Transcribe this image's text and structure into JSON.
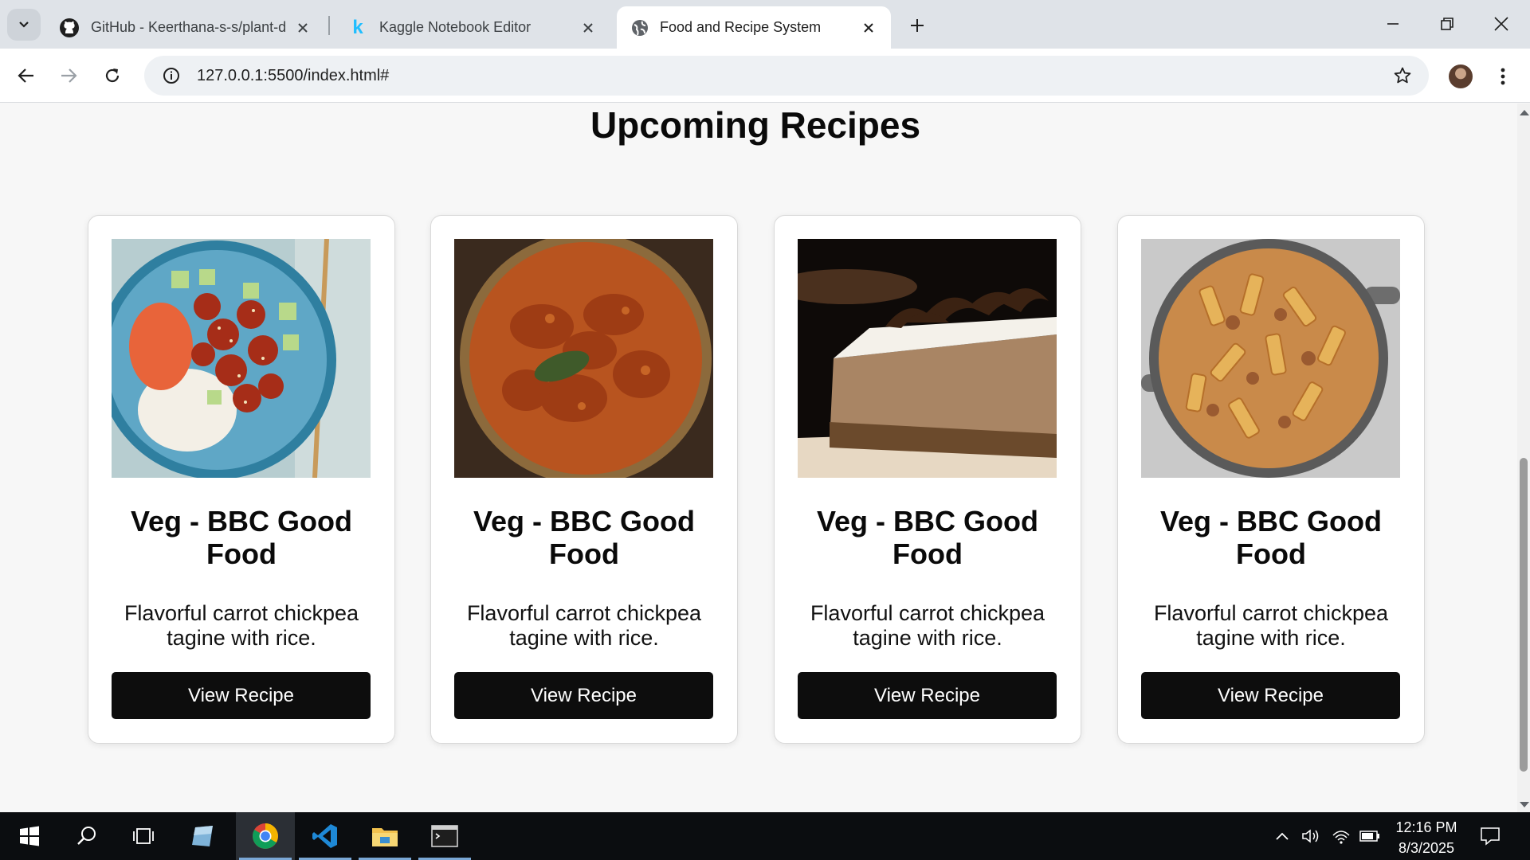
{
  "browser": {
    "tabs": [
      {
        "title": "GitHub - Keerthana-s-s/plant-d",
        "icon": "github-icon"
      },
      {
        "title": "Kaggle Notebook Editor",
        "icon": "kaggle-icon"
      },
      {
        "title": "Food and Recipe System",
        "icon": "globe-icon",
        "active": true
      }
    ],
    "url": "127.0.0.1:5500/index.html#"
  },
  "page": {
    "section_title": "Upcoming Recipes",
    "cards": [
      {
        "title": "Veg - BBC Good Food",
        "description": "Flavorful carrot chickpea tagine with rice.",
        "button": "View Recipe",
        "image": "sesame-chicken-rice-bowl"
      },
      {
        "title": "Veg - BBC Good Food",
        "description": "Flavorful carrot chickpea tagine with rice.",
        "button": "View Recipe",
        "image": "chicken-curry-bowl"
      },
      {
        "title": "Veg - BBC Good Food",
        "description": "Flavorful carrot chickpea tagine with rice.",
        "button": "View Recipe",
        "image": "chocolate-cream-pie-slice"
      },
      {
        "title": "Veg - BBC Good Food",
        "description": "Flavorful carrot chickpea tagine with rice.",
        "button": "View Recipe",
        "image": "rigatoni-pasta-pan"
      }
    ]
  },
  "taskbar": {
    "time": "12:16 PM",
    "date": "8/3/2025",
    "apps": [
      "windows-start",
      "search",
      "task-view",
      "notes",
      "chrome",
      "vscode",
      "file-explorer",
      "terminal"
    ]
  },
  "colors": {
    "button_bg": "#0d0d0d",
    "page_bg": "#f7f7f7",
    "tabstrip_bg": "#dfe3e8",
    "taskbar_bg": "#0b0d10"
  }
}
